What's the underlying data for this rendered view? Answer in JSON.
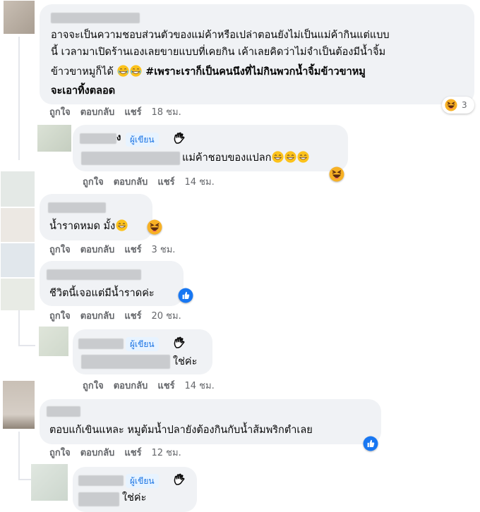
{
  "comment1": {
    "lines": [
      "อาจจะเป็นความชอบส่วนตัวของแม่ค้าหรือเปล่าตอนยังไม่เป็นแม่ค้ากินแต่แบบ",
      "นี้ เวลามาเปิดร้านเองเลยขายแบบที่เคยกิน เค้าเลยคิดว่าไม่จำเป็นต้องมีน้ำจิ้ม",
      "ข้าวขาหมูก็ได้"
    ],
    "hashtag1": "#เพราะเราก็เป็นคนนึงที่ไม่กินพวกน้ำจิ้มข้าวขาหมู",
    "hashtag2": "จะเอาทิ้งตลอด",
    "react_count": "3",
    "like": "ถูกใจ",
    "reply": "ตอบกลับ",
    "share": "แชร์",
    "time": "18 ชม."
  },
  "reply1": {
    "name_suffix": "ง",
    "badge": "ผู้เขียน",
    "text": "แม่ค้าชอบของแปลก",
    "like": "ถูกใจ",
    "reply": "ตอบกลับ",
    "share": "แชร์",
    "time": "14 ชม."
  },
  "comment2": {
    "text": "น้ำราดหมด มั้ง",
    "like": "ถูกใจ",
    "reply": "ตอบกลับ",
    "share": "แชร์",
    "time": "3 ชม."
  },
  "comment3": {
    "text": "ชีวิตนี้เจอแต่มีน้ำราดค่ะ",
    "like": "ถูกใจ",
    "reply": "ตอบกลับ",
    "share": "แชร์",
    "time": "20 ชม."
  },
  "reply2": {
    "badge": "ผู้เขียน",
    "text": "ใช่ค่ะ",
    "like": "ถูกใจ",
    "reply": "ตอบกลับ",
    "share": "แชร์",
    "time": "14 ชม."
  },
  "comment4": {
    "text": "ตอบแก้เขินแหละ หมูต้มน้ำปลายังต้องกินกับน้ำส้มพริกตำเลย",
    "like": "ถูกใจ",
    "reply": "ตอบกลับ",
    "share": "แชร์",
    "time": "12 ชม."
  },
  "reply3": {
    "badge": "ผู้เขียน",
    "text": "ใช่ค่ะ"
  },
  "colors": {
    "bubble": "#f0f2f5",
    "secondary_text": "#65676b",
    "badge_bg": "#e7f3ff",
    "badge_text": "#1b74e4",
    "like_blue": "#1877f2"
  }
}
